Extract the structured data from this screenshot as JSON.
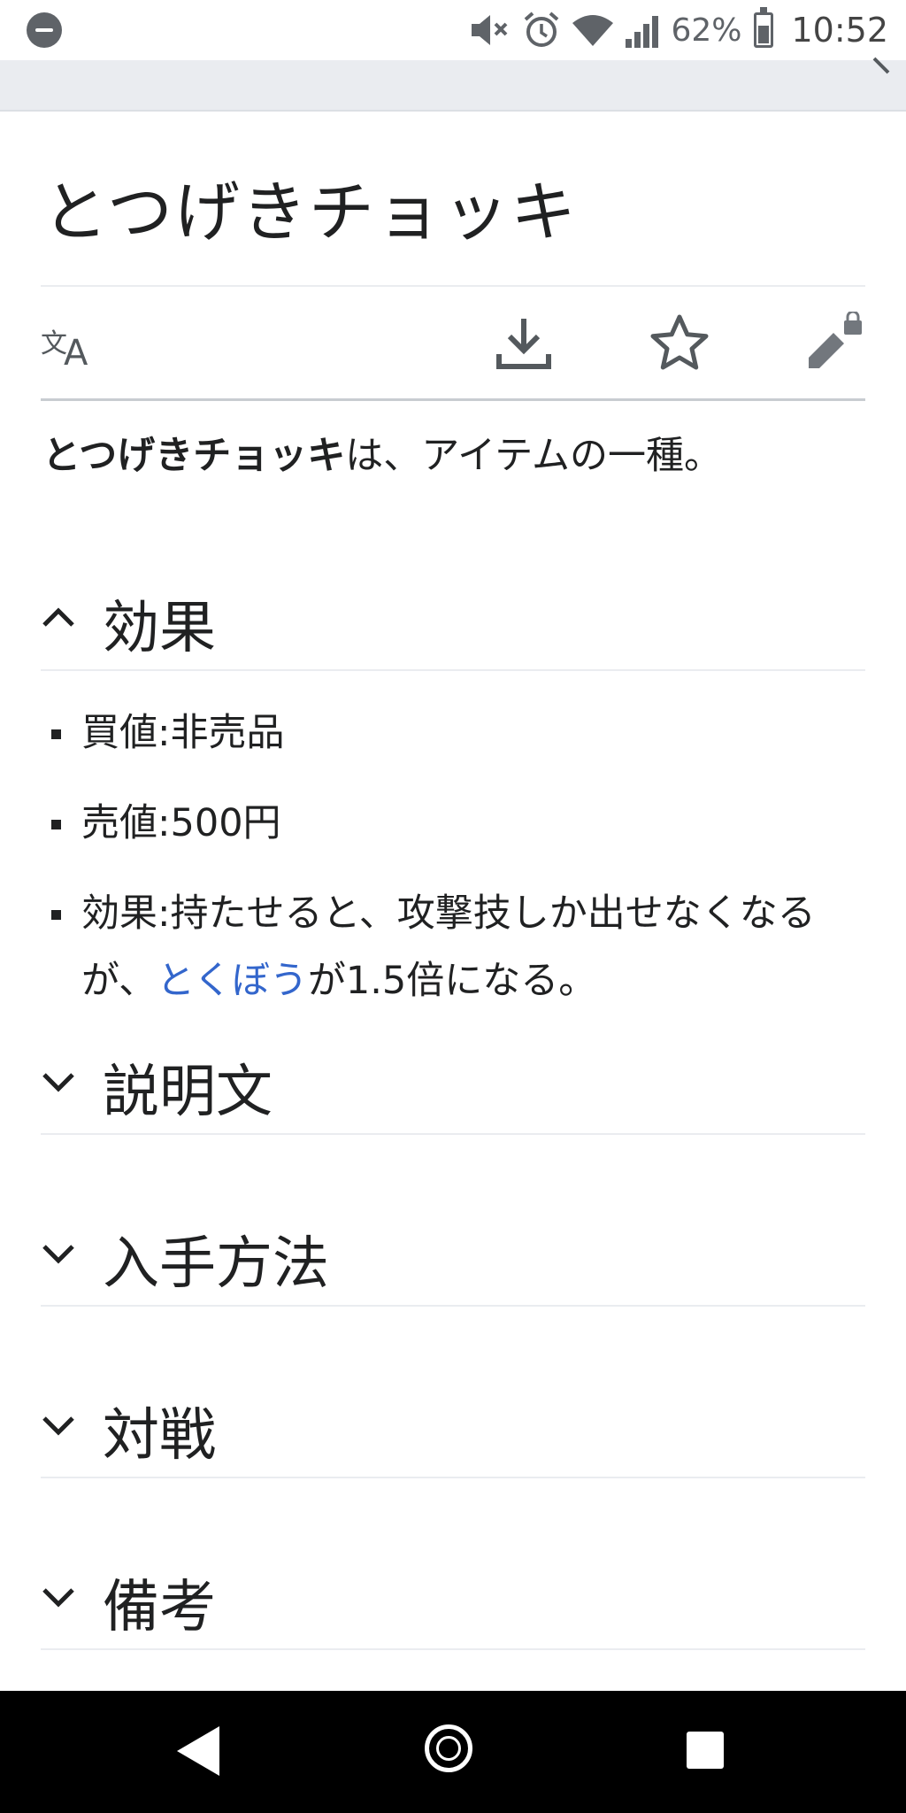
{
  "status_bar": {
    "battery_percent": "62%",
    "time": "10:52",
    "icons": [
      "do-not-disturb-icon",
      "mute-icon",
      "alarm-icon",
      "wifi-icon",
      "signal-icon",
      "battery-icon"
    ]
  },
  "article": {
    "title": "とつげきチョッキ",
    "toolbar": {
      "icons": [
        "language-icon",
        "download-icon",
        "star-icon",
        "edit-lock-icon"
      ]
    },
    "intro": {
      "bold": "とつげきチョッキ",
      "rest": "は、アイテムの一種。"
    },
    "sections": [
      {
        "title": "効果",
        "expanded": true,
        "items": [
          {
            "text": "買値:非売品"
          },
          {
            "text": "売値:500円"
          },
          {
            "pre": "効果:持たせると、攻撃技しか出せなくなるが、",
            "link": "とくぼう",
            "post": "が1.5倍になる。"
          }
        ]
      },
      {
        "title": "説明文",
        "expanded": false
      },
      {
        "title": "入手方法",
        "expanded": false
      },
      {
        "title": "対戦",
        "expanded": false
      },
      {
        "title": "備考",
        "expanded": false
      }
    ]
  },
  "navigation_bar": {
    "icons": [
      "back-icon",
      "home-icon",
      "recents-icon"
    ]
  }
}
